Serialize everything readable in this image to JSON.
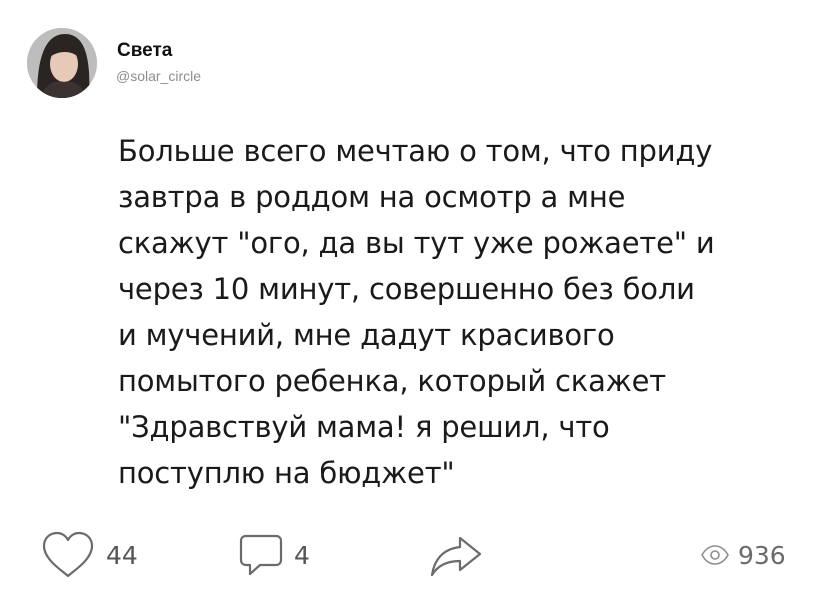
{
  "author": {
    "name": "Света",
    "handle": "@solar_circle"
  },
  "post": {
    "lines": [
      "Больше всего мечтаю о том, что приду",
      "завтра в роддом на осмотр а мне",
      "скажут \"ого, да вы тут уже рожаете\" и",
      "через 10 минут, совершенно без боли",
      "и мучений, мне дадут красивого",
      "помытого ребенка, который скажет",
      "\"Здравствуй мама! я решил, что",
      "поступлю на бюджет\""
    ]
  },
  "actions": {
    "likes": "44",
    "comments": "4",
    "views": "936"
  },
  "icons": {
    "like": "heart-outline-icon",
    "comment": "speech-bubble-icon",
    "share": "share-arrow-icon",
    "views": "eye-icon"
  },
  "colors": {
    "text": "#1a1a1a",
    "muted": "#8d8d8d",
    "icon": "#6b6b6b"
  }
}
